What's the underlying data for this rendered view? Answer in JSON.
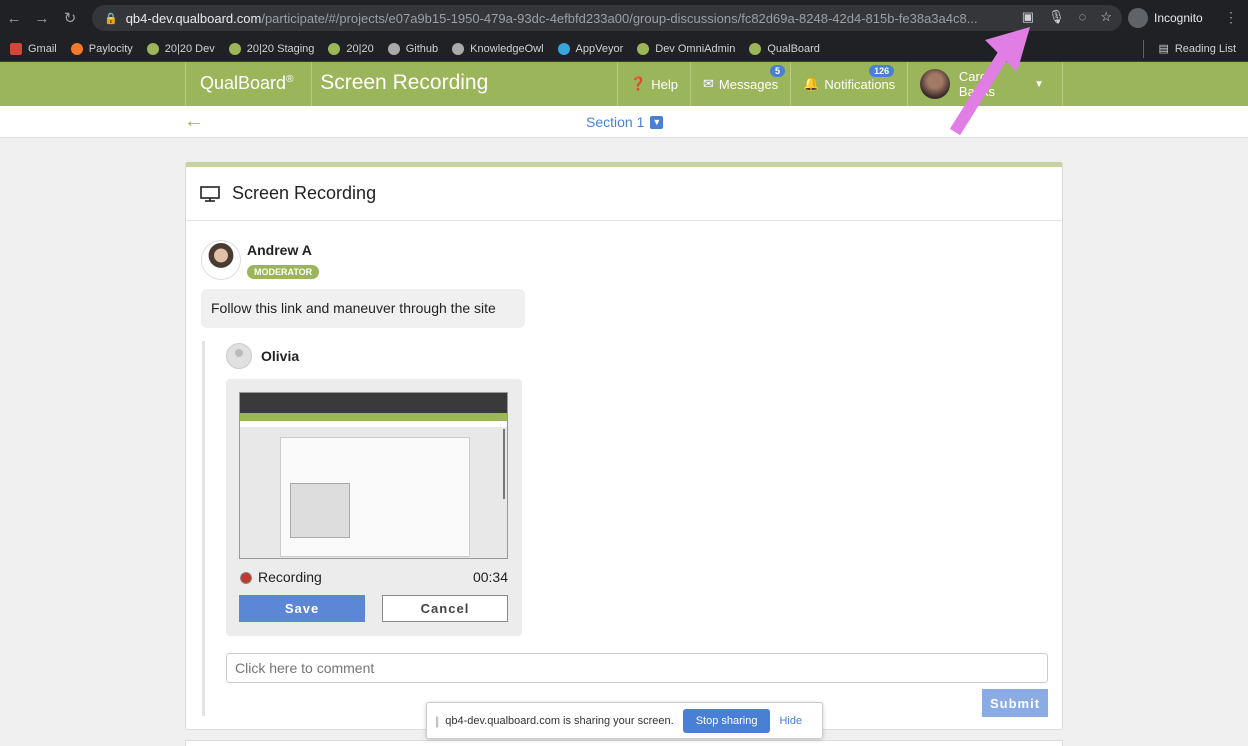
{
  "browser": {
    "url_host": "qb4-dev.qualboard.com",
    "url_path": "/participate/#/projects/e07a9b15-1950-479a-93dc-4efbfd233a00/group-discussions/fc82d69a-8248-42d4-815b-fe38a3a4c8...",
    "incognito_label": "Incognito",
    "bookmarks": [
      "Gmail",
      "Paylocity",
      "20|20 Dev",
      "20|20 Staging",
      "20|20",
      "Github",
      "KnowledgeOwl",
      "AppVeyor",
      "Dev OmniAdmin",
      "QualBoard"
    ],
    "reading_list": "Reading List"
  },
  "header": {
    "brand": "QualBoard",
    "brand_mark": "®",
    "title": "Screen Recording",
    "help": "Help",
    "messages": "Messages",
    "messages_count": "5",
    "notifications": "Notifications",
    "notifications_count": "126",
    "user": "Carol Banks"
  },
  "subbar": {
    "section": "Section 1"
  },
  "card": {
    "title": "Screen Recording",
    "post": {
      "author": "Andrew A",
      "role": "MODERATOR",
      "body": "Follow this link and maneuver through the site"
    },
    "reply": {
      "author": "Olivia",
      "recording_label": "Recording",
      "recording_time": "00:34",
      "save": "Save",
      "cancel": "Cancel"
    },
    "comment_placeholder": "Click here to comment",
    "submit": "Submit"
  },
  "sharebar": {
    "text": "qb4-dev.qualboard.com is sharing your screen.",
    "stop": "Stop sharing",
    "hide": "Hide"
  },
  "colors": {
    "brand_green": "#9bb55a",
    "link_blue": "#4a7fd6",
    "annotation": "#e07ee6"
  }
}
